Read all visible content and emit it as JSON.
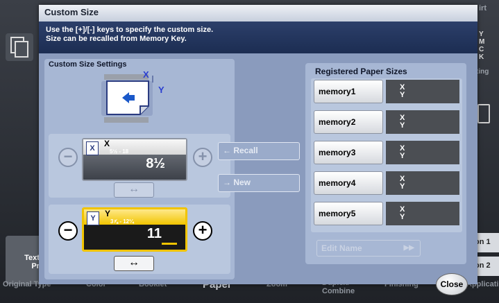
{
  "background": {
    "tabs_top": [
      "Pr",
      "irt"
    ],
    "bottom_tabs": [
      "Original Type",
      "Color",
      "Booklet",
      "Paper",
      "Zoom",
      "Duplex/\nCombine",
      "Finishing",
      "Application"
    ],
    "left_button": "Text/\nPri",
    "right_cmyk": [
      "Y",
      "M",
      "C",
      "K"
    ],
    "right_label": "ting",
    "right_buttons": [
      "on 1",
      "on 2"
    ]
  },
  "dialog": {
    "title": "Custom Size",
    "instruction_line1": "Use the [+]/[-] keys to specify the custom size.",
    "instruction_line2": "Size can be recalled from Memory Key."
  },
  "custom_settings": {
    "title": "Custom Size Settings",
    "diagram": {
      "x_label": "X",
      "y_label": "Y"
    },
    "x": {
      "letter": "X",
      "icon": "X",
      "range": "5½ - 18",
      "value": "8½"
    },
    "y": {
      "letter": "Y",
      "icon": "Y",
      "range": "3⅞ - 12¼",
      "value": "11"
    },
    "minus": "−",
    "plus": "+",
    "swap": "↔"
  },
  "middle": {
    "recall_label": "← Recall",
    "new_label": "→ New"
  },
  "registered": {
    "title": "Registered Paper Sizes",
    "memories": [
      {
        "label": "memory1",
        "x": "X",
        "y": "Y"
      },
      {
        "label": "memory2",
        "x": "X",
        "y": "Y"
      },
      {
        "label": "memory3",
        "x": "X",
        "y": "Y"
      },
      {
        "label": "memory4",
        "x": "X",
        "y": "Y"
      },
      {
        "label": "memory5",
        "x": "X",
        "y": "Y"
      }
    ],
    "edit_name": "Edit Name",
    "edit_name_arrow": "▶▶"
  },
  "close_label": "Close"
}
